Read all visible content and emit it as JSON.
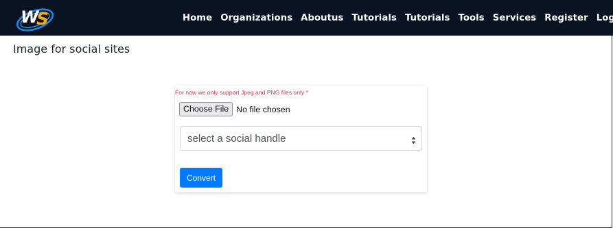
{
  "navbar": {
    "logo_icon": "ws-logo-icon",
    "items": [
      "Home",
      "Organizations",
      "Aboutus",
      "Tutorials",
      "Tutorials",
      "Tools",
      "Services",
      "Register",
      "Login"
    ]
  },
  "page": {
    "title": "Image for social sites"
  },
  "form": {
    "warning": "For now we only support Jpeg and PNG files only *",
    "file_button_label": "Choose File",
    "file_status": "No file chosen",
    "select_value": "select a social handle",
    "convert_label": "Convert"
  },
  "colors": {
    "navbar_bg": "#091322",
    "warning": "#dc3545",
    "primary": "#007bff"
  }
}
